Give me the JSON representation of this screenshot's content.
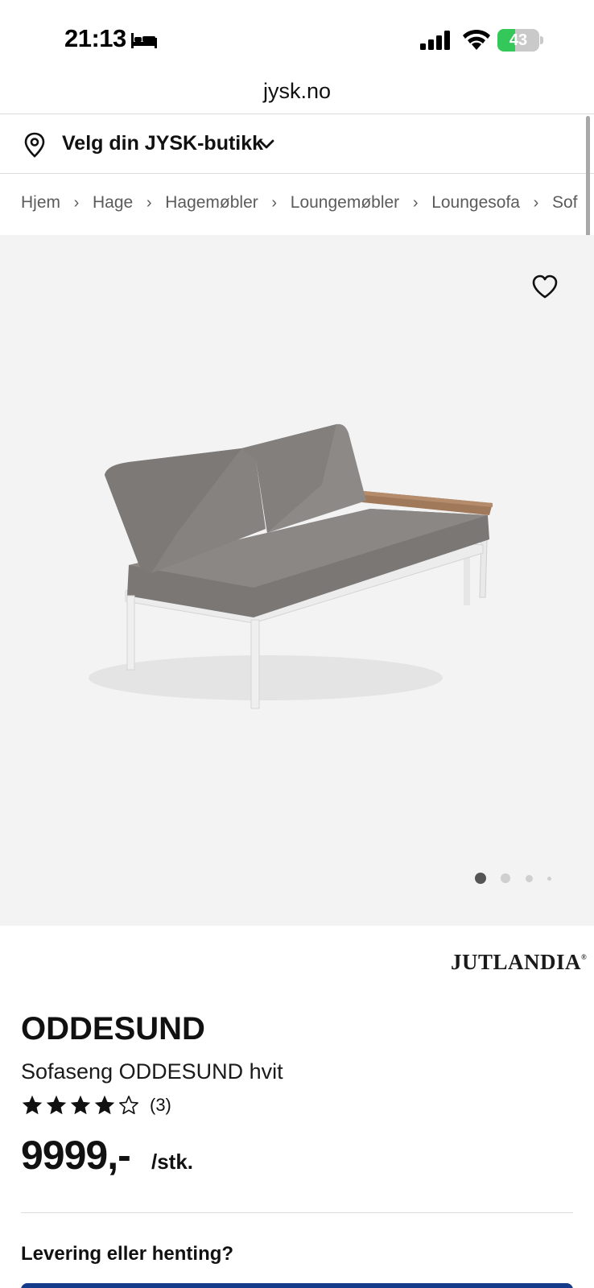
{
  "status_bar": {
    "time": "21:13",
    "battery_percent": "43",
    "battery_level": 0.43,
    "icons": [
      "bed-icon",
      "cellular-signal-icon",
      "wifi-icon",
      "battery-charging-icon"
    ]
  },
  "url_bar": {
    "url": "jysk.no"
  },
  "store_selector": {
    "label": "Velg din JYSK-butikk",
    "icons": [
      "location-pin-icon",
      "chevron-down-icon"
    ]
  },
  "breadcrumb": {
    "items": [
      "Hjem",
      "Hage",
      "Hagemøbler",
      "Loungemøbler",
      "Loungesofa",
      "Sof"
    ],
    "separator": "›"
  },
  "gallery": {
    "favorite_icon": "heart-icon",
    "image_count": 4,
    "active_index": 0
  },
  "product": {
    "brand": "JUTLANDIA",
    "brand_mark": "®",
    "name": "ODDESUND",
    "description": "Sofaseng ODDESUND hvit",
    "rating_value": 4,
    "rating_max": 5,
    "review_count": "(3)",
    "price": "9999,-",
    "price_unit": "/stk."
  },
  "delivery": {
    "title": "Levering eller henting?"
  },
  "colors": {
    "accent_blue": "#143c8a",
    "battery_green": "#34c759",
    "image_background": "#f3f3f3"
  }
}
